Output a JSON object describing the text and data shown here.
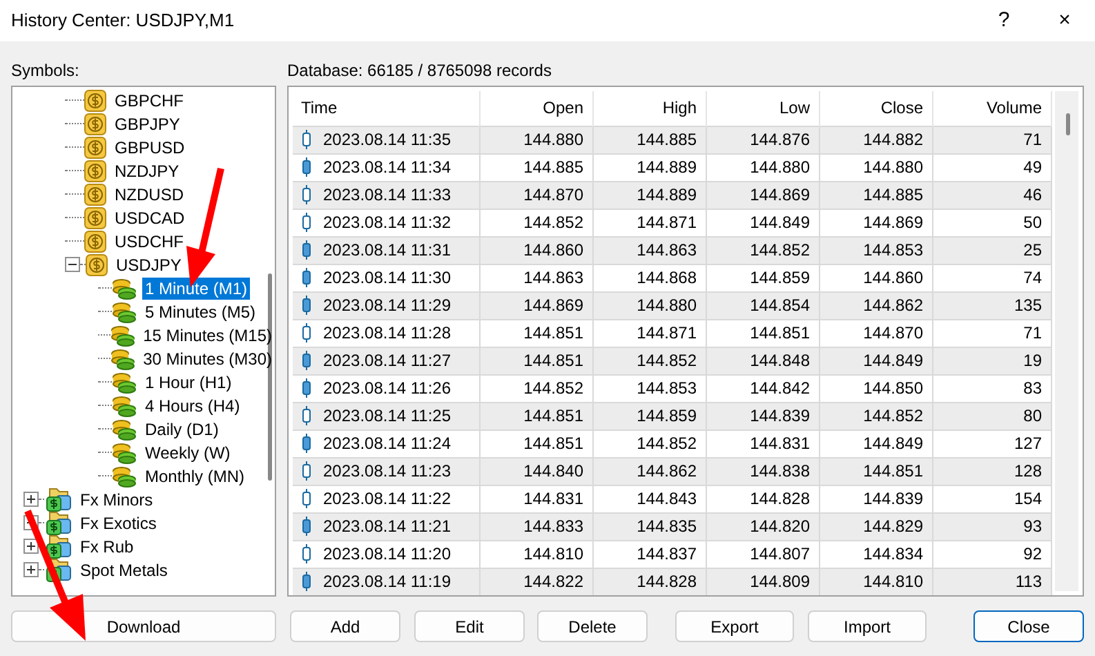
{
  "window": {
    "title": "History Center: USDJPY,M1",
    "help": "?",
    "close": "×"
  },
  "symbols_label": "Symbols:",
  "tree": [
    {
      "label": "GBPCHF",
      "kind": "symbol"
    },
    {
      "label": "GBPJPY",
      "kind": "symbol"
    },
    {
      "label": "GBPUSD",
      "kind": "symbol"
    },
    {
      "label": "NZDJPY",
      "kind": "symbol"
    },
    {
      "label": "NZDUSD",
      "kind": "symbol"
    },
    {
      "label": "USDCAD",
      "kind": "symbol"
    },
    {
      "label": "USDCHF",
      "kind": "symbol"
    },
    {
      "label": "USDJPY",
      "kind": "symbol",
      "expanded": true,
      "children": [
        {
          "label": "1 Minute (M1)",
          "kind": "period",
          "selected": true
        },
        {
          "label": "5 Minutes (M5)",
          "kind": "period",
          "selected": false
        },
        {
          "label": "15 Minutes (M15)",
          "kind": "period",
          "selected": false
        },
        {
          "label": "30 Minutes (M30)",
          "kind": "period",
          "selected": false
        },
        {
          "label": "1 Hour (H1)",
          "kind": "period",
          "selected": false
        },
        {
          "label": "4 Hours (H4)",
          "kind": "period",
          "selected": false
        },
        {
          "label": "Daily (D1)",
          "kind": "period",
          "selected": false
        },
        {
          "label": "Weekly (W)",
          "kind": "period",
          "selected": false
        },
        {
          "label": "Monthly (MN)",
          "kind": "period",
          "selected": false
        }
      ]
    },
    {
      "label": "Fx Minors",
      "kind": "group",
      "expanded": false
    },
    {
      "label": "Fx Exotics",
      "kind": "group",
      "expanded": false
    },
    {
      "label": "Fx Rub",
      "kind": "group",
      "expanded": false
    },
    {
      "label": "Spot Metals",
      "kind": "group",
      "expanded": false
    }
  ],
  "download_button": "Download",
  "database_label": "Database: 66185 / 8765098 records",
  "table": {
    "columns": [
      "Time",
      "Open",
      "High",
      "Low",
      "Close",
      "Volume"
    ],
    "rows": [
      {
        "kind": "bull",
        "cells": [
          "2023.08.14 11:35",
          "144.880",
          "144.885",
          "144.876",
          "144.882",
          "71"
        ]
      },
      {
        "kind": "bear",
        "cells": [
          "2023.08.14 11:34",
          "144.885",
          "144.889",
          "144.880",
          "144.880",
          "49"
        ]
      },
      {
        "kind": "bull",
        "cells": [
          "2023.08.14 11:33",
          "144.870",
          "144.889",
          "144.869",
          "144.885",
          "46"
        ]
      },
      {
        "kind": "bull",
        "cells": [
          "2023.08.14 11:32",
          "144.852",
          "144.871",
          "144.849",
          "144.869",
          "50"
        ]
      },
      {
        "kind": "bear",
        "cells": [
          "2023.08.14 11:31",
          "144.860",
          "144.863",
          "144.852",
          "144.853",
          "25"
        ]
      },
      {
        "kind": "bear",
        "cells": [
          "2023.08.14 11:30",
          "144.863",
          "144.868",
          "144.859",
          "144.860",
          "74"
        ]
      },
      {
        "kind": "bear",
        "cells": [
          "2023.08.14 11:29",
          "144.869",
          "144.880",
          "144.854",
          "144.862",
          "135"
        ]
      },
      {
        "kind": "bull",
        "cells": [
          "2023.08.14 11:28",
          "144.851",
          "144.871",
          "144.851",
          "144.870",
          "71"
        ]
      },
      {
        "kind": "bear",
        "cells": [
          "2023.08.14 11:27",
          "144.851",
          "144.852",
          "144.848",
          "144.849",
          "19"
        ]
      },
      {
        "kind": "bear",
        "cells": [
          "2023.08.14 11:26",
          "144.852",
          "144.853",
          "144.842",
          "144.850",
          "83"
        ]
      },
      {
        "kind": "bull",
        "cells": [
          "2023.08.14 11:25",
          "144.851",
          "144.859",
          "144.839",
          "144.852",
          "80"
        ]
      },
      {
        "kind": "bear",
        "cells": [
          "2023.08.14 11:24",
          "144.851",
          "144.852",
          "144.831",
          "144.849",
          "127"
        ]
      },
      {
        "kind": "bull",
        "cells": [
          "2023.08.14 11:23",
          "144.840",
          "144.862",
          "144.838",
          "144.851",
          "128"
        ]
      },
      {
        "kind": "bull",
        "cells": [
          "2023.08.14 11:22",
          "144.831",
          "144.843",
          "144.828",
          "144.839",
          "154"
        ]
      },
      {
        "kind": "bear",
        "cells": [
          "2023.08.14 11:21",
          "144.833",
          "144.835",
          "144.820",
          "144.829",
          "93"
        ]
      },
      {
        "kind": "bull",
        "cells": [
          "2023.08.14 11:20",
          "144.810",
          "144.837",
          "144.807",
          "144.834",
          "92"
        ]
      },
      {
        "kind": "bear",
        "cells": [
          "2023.08.14 11:19",
          "144.822",
          "144.828",
          "144.809",
          "144.810",
          "113"
        ]
      }
    ]
  },
  "buttons": [
    {
      "label": "Add",
      "default": false
    },
    {
      "label": "Edit",
      "default": false
    },
    {
      "label": "Delete",
      "default": false
    },
    {
      "label": "Export",
      "default": false
    },
    {
      "label": "Import",
      "default": false
    },
    {
      "label": "Close",
      "default": true
    }
  ]
}
